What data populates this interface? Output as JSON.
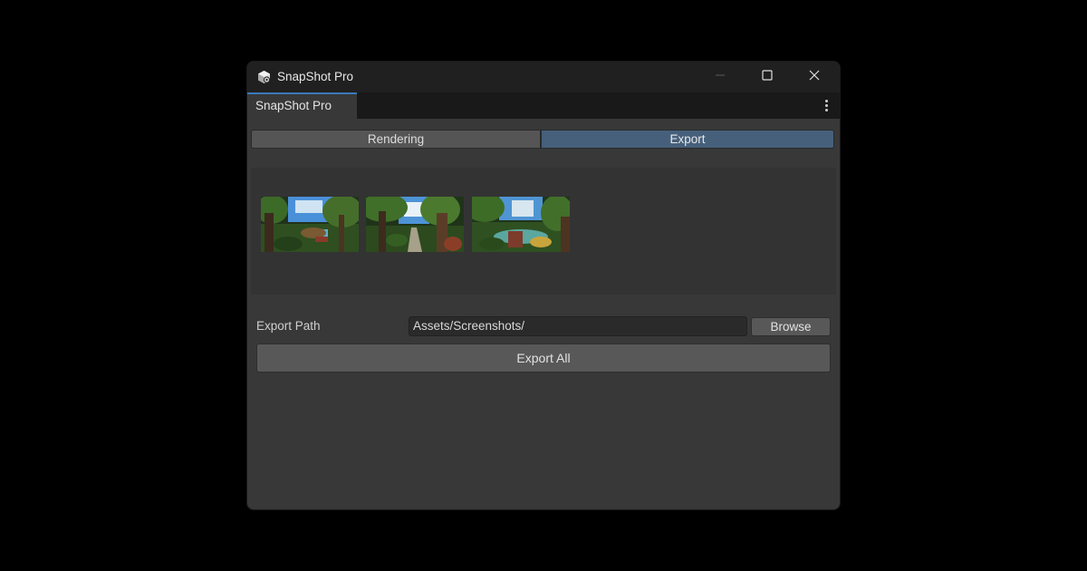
{
  "window": {
    "title": "SnapShot Pro",
    "icon": "unity-cube-gear-icon"
  },
  "tabbar": {
    "active_tab": "SnapShot Pro",
    "menu_icon": "more-vertical-icon"
  },
  "toolbar": {
    "items": [
      {
        "label": "Rendering",
        "selected": false
      },
      {
        "label": "Export",
        "selected": true
      }
    ]
  },
  "gallery": {
    "thumbnails": [
      {
        "name": "forest-screenshot-1"
      },
      {
        "name": "forest-screenshot-2"
      },
      {
        "name": "forest-screenshot-3"
      }
    ]
  },
  "export": {
    "path_label": "Export Path",
    "path_value": "Assets/Screenshots/",
    "browse_label": "Browse",
    "export_all_label": "Export All"
  },
  "colors": {
    "accent": "#3a79bb",
    "selected_tab": "#46607c",
    "panel": "#383838",
    "background": "#000000"
  }
}
